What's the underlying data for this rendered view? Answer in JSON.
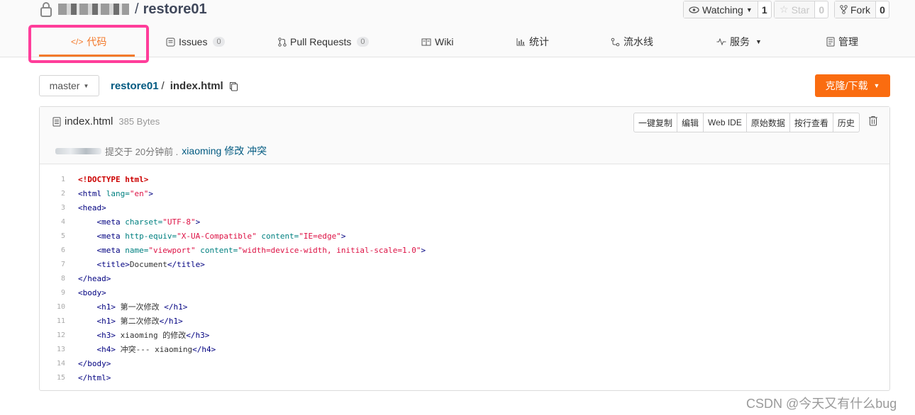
{
  "repo": {
    "owner_blurred": "",
    "name": "restore01"
  },
  "social": {
    "watch_label": "Watching",
    "watch_count": "1",
    "star_label": "Star",
    "star_count": "0",
    "fork_label": "Fork",
    "fork_count": "0"
  },
  "tabs": [
    {
      "label": "代码",
      "icon": "code-icon"
    },
    {
      "label": "Issues",
      "count": "0",
      "icon": "issues-icon"
    },
    {
      "label": "Pull Requests",
      "count": "0",
      "icon": "pull-request-icon"
    },
    {
      "label": "Wiki",
      "icon": "wiki-icon"
    },
    {
      "label": "统计",
      "icon": "chart-icon"
    },
    {
      "label": "流水线",
      "icon": "pipeline-icon"
    },
    {
      "label": "服务",
      "icon": "pulse-icon"
    },
    {
      "label": "管理",
      "icon": "settings-doc-icon"
    }
  ],
  "branch": {
    "label": "master"
  },
  "breadcrumb": {
    "repo": "restore01",
    "sep": "/",
    "file": "index.html"
  },
  "clone_button": "克隆/下载",
  "file": {
    "name": "index.html",
    "size": "385 Bytes"
  },
  "actions": [
    "一键复制",
    "编辑",
    "Web IDE",
    "原始数据",
    "按行查看",
    "历史"
  ],
  "commit": {
    "text": "提交于 20分钟前 .",
    "message": "xiaoming 修改 冲突"
  },
  "code_lines": [
    "1",
    "2",
    "3",
    "4",
    "5",
    "6",
    "7",
    "8",
    "9",
    "10",
    "11",
    "12",
    "13",
    "14",
    "15"
  ],
  "code_text": {
    "doctype": "<!DOCTYPE html>",
    "html_open": "<html",
    "lang_attr": " lang=",
    "lang_val": "\"en\"",
    "gt": ">",
    "head_open": "<head>",
    "meta": "<meta",
    "charset_attr": " charset=",
    "charset_val": "\"UTF-8\"",
    "httpequiv_attr": " http-equiv=",
    "httpequiv_val": "\"X-UA-Compatible\"",
    "content_attr": " content=",
    "content_val1": "\"IE=edge\"",
    "name_attr": " name=",
    "name_val": "\"viewport\"",
    "content_val2": "\"width=device-width, initial-scale=1.0\"",
    "title_open": "<title>",
    "title_text": "Document",
    "title_close": "</title>",
    "head_close": "</head>",
    "body_open": "<body>",
    "h1_open": "<h1>",
    "h1_close": "</h1>",
    "h1_text1": " 第一次修改 ",
    "h1_text2": " 第二次修改",
    "h3_open": "<h3>",
    "h3_text": " xiaoming 的修改",
    "h3_close": "</h3>",
    "h4_open": "<h4>",
    "h4_text": " 冲突--- xiaoming",
    "h4_close": "</h4>",
    "body_close": "</body>",
    "html_close": "</html>"
  },
  "watermark": "CSDN @今天又有什么bug",
  "colors": {
    "accent": "#f3792b",
    "clone": "#fa6c10",
    "highlight": "#ff3d9a",
    "link": "#005980"
  }
}
